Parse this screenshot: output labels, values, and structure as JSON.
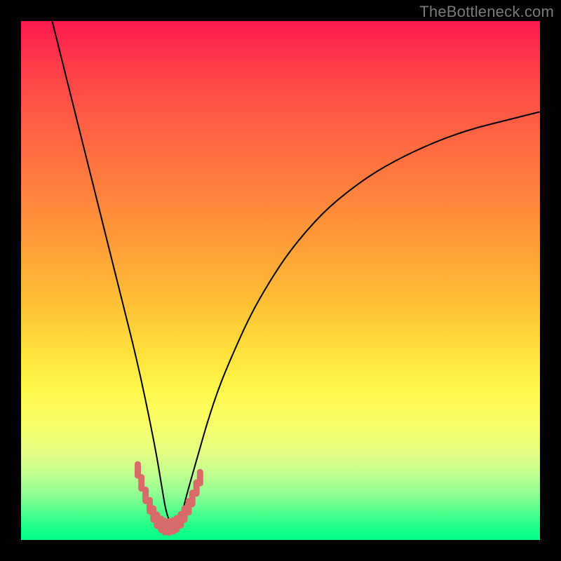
{
  "watermark": {
    "text": "TheBottleneck.com"
  },
  "chart_data": {
    "type": "line",
    "title": "",
    "xlabel": "",
    "ylabel": "",
    "x_range_pct": [
      0,
      100
    ],
    "y_range_pct": [
      0,
      100
    ],
    "notes": "V-shaped bottleneck curve. x is horizontal position as a percentage of the colored plot area (0=left,100=right). y is height reached as a percentage of the plot area (0=bottom/green, 100=top/red). Minimum is near x≈28%.",
    "series": [
      {
        "name": "main-curve",
        "color": "#000000",
        "x": [
          6,
          8,
          10,
          12,
          14,
          16,
          18,
          20,
          22,
          24,
          26,
          27,
          28,
          29,
          30,
          31,
          32,
          34,
          36,
          38,
          40,
          44,
          48,
          52,
          58,
          64,
          70,
          78,
          86,
          94,
          100
        ],
        "y": [
          100,
          92,
          84,
          76,
          68,
          60,
          52,
          44,
          36,
          27,
          17,
          11,
          5,
          3,
          3,
          5,
          9,
          16,
          23,
          29,
          34,
          43,
          50,
          56,
          63,
          68,
          72,
          76,
          79,
          81,
          82.5
        ]
      },
      {
        "name": "threshold-markers",
        "color": "#d96a6a",
        "type": "scatter",
        "notes": "Short pink marker strokes hugging the bottom of the V where the curve crosses the green zone",
        "x": [
          22.5,
          23.2,
          24.0,
          24.8,
          25.5,
          26.2,
          27.0,
          27.7,
          28.5,
          29.3,
          30.0,
          30.8,
          31.5,
          32.3,
          33.0,
          33.8,
          34.5
        ],
        "y": [
          13.5,
          11.0,
          8.6,
          6.6,
          5.0,
          3.8,
          3.0,
          2.6,
          2.5,
          2.7,
          3.1,
          3.9,
          5.0,
          6.4,
          8.0,
          10.0,
          12.0
        ]
      }
    ],
    "background_gradient": {
      "top": "#ff1a4d",
      "middle": "#ffe23d",
      "bottom": "#00ff88"
    }
  },
  "colors": {
    "frame": "#000000",
    "curve": "#000000",
    "marker": "#d96a6a",
    "watermark": "#7a7a7a"
  }
}
